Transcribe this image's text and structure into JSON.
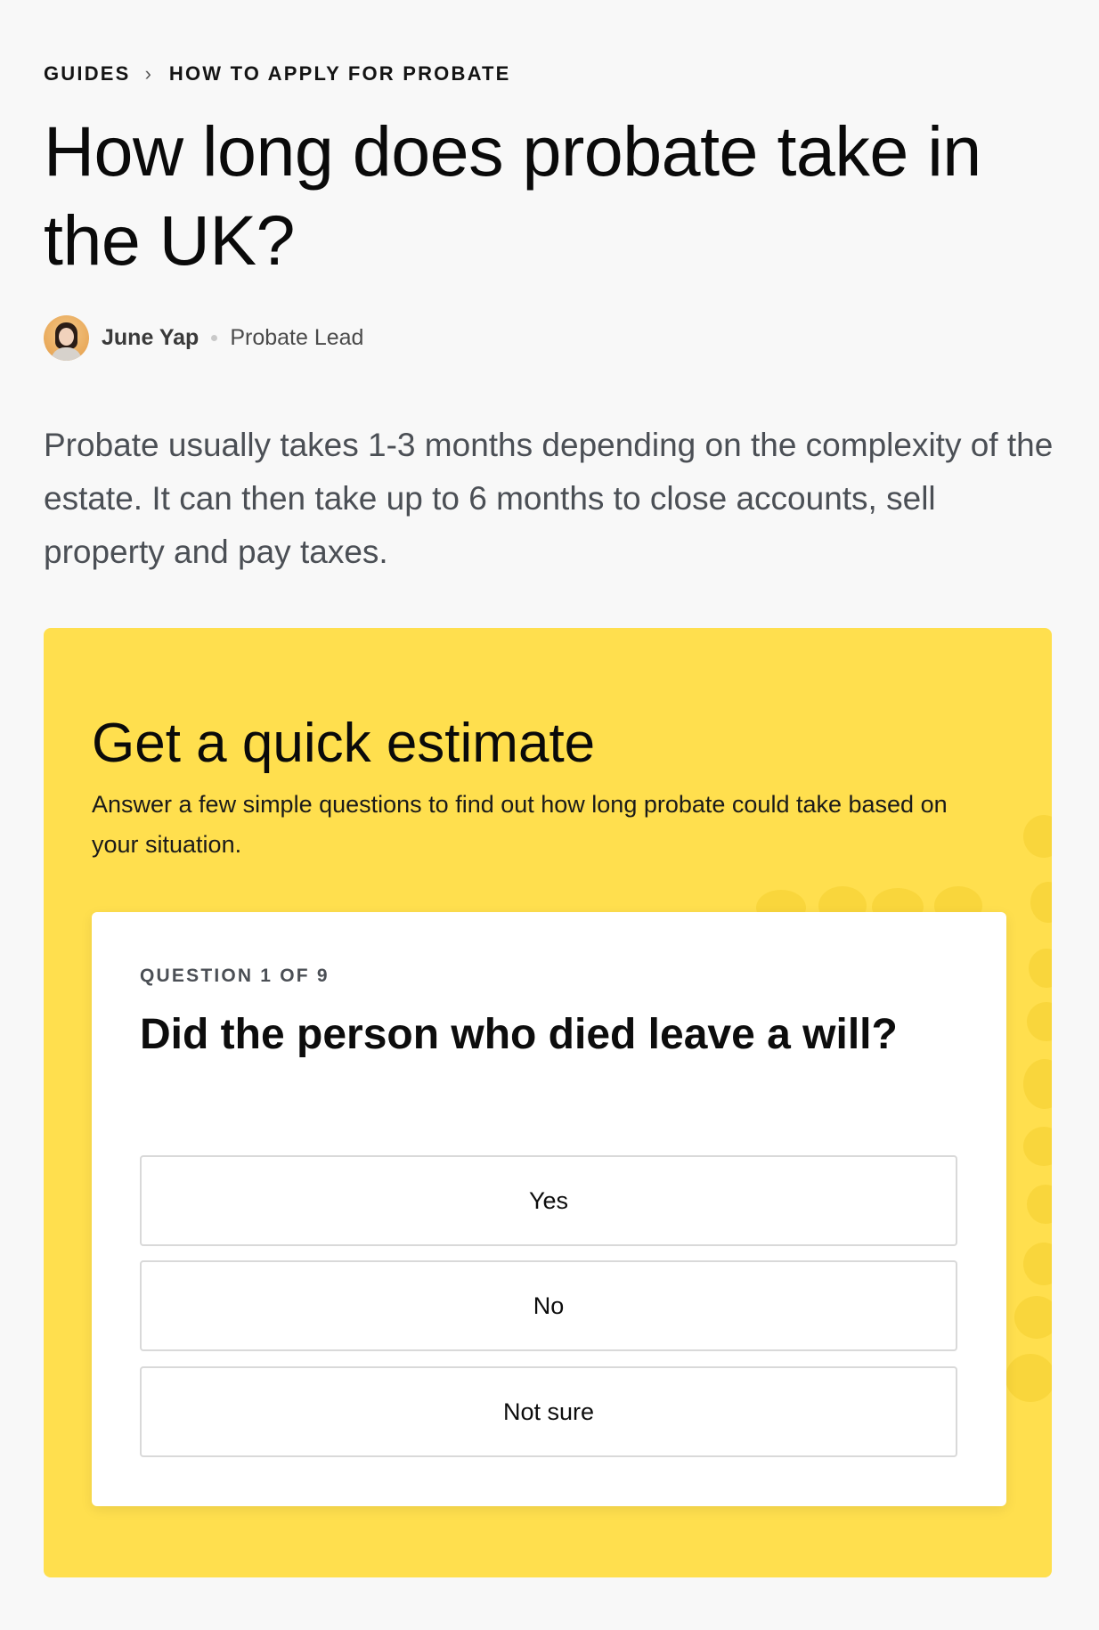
{
  "breadcrumb": {
    "items": [
      "GUIDES",
      "HOW TO APPLY FOR PROBATE"
    ],
    "separator": "›"
  },
  "page_title": "How long does probate take in the UK?",
  "author": {
    "name": "June Yap",
    "role": "Probate Lead"
  },
  "intro": "Probate usually takes 1-3 months depending on the complexity of the estate. It can then take up to 6 months to close accounts, sell property and pay taxes.",
  "estimate": {
    "title": "Get a quick estimate",
    "subtitle": "Answer a few simple questions to find out how long probate could take based on your situation.",
    "background_color": "#ffdf4e",
    "question": {
      "counter": "QUESTION 1 OF 9",
      "text": "Did the person who died leave a will?",
      "answers": [
        "Yes",
        "No",
        "Not sure"
      ]
    }
  }
}
